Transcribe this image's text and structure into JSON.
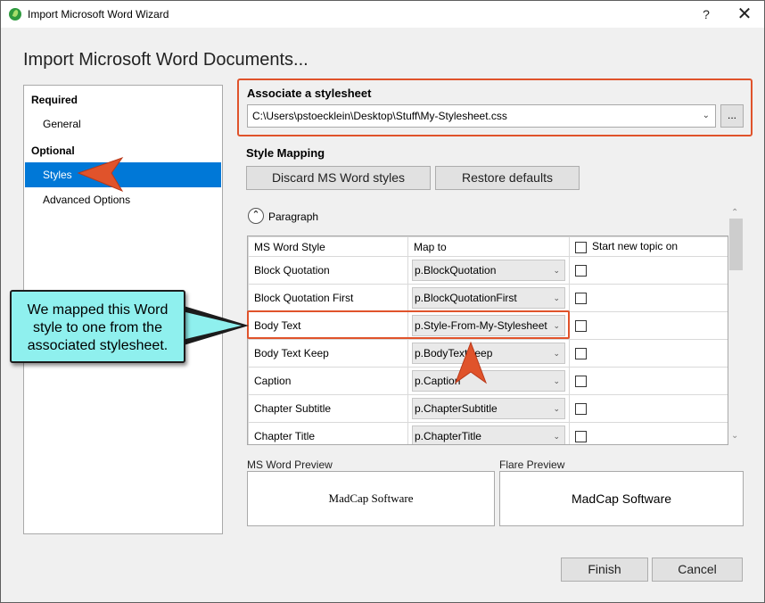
{
  "window": {
    "title": "Import Microsoft Word Wizard",
    "help_label": "?",
    "close_label": "✕",
    "heading": "Import Microsoft Word Documents..."
  },
  "nav": {
    "required_label": "Required",
    "general_label": "General",
    "optional_label": "Optional",
    "styles_label": "Styles",
    "advanced_label": "Advanced Options",
    "selected": "Styles"
  },
  "stylesheet": {
    "title": "Associate a stylesheet",
    "path": "C:\\Users\\pstoecklein\\Desktop\\Stuff\\My-Stylesheet.css",
    "browse_label": "..."
  },
  "style_mapping": {
    "title": "Style Mapping",
    "discard_label": "Discard MS Word styles",
    "restore_label": "Restore defaults",
    "section_label": "Paragraph",
    "columns": [
      "MS Word Style",
      "Map to",
      "Start new topic on"
    ],
    "rows": [
      {
        "style": "Block Quotation",
        "map_to": "p.BlockQuotation"
      },
      {
        "style": "Block Quotation First",
        "map_to": "p.BlockQuotationFirst"
      },
      {
        "style": "Body Text",
        "map_to": "p.Style-From-My-Stylesheet"
      },
      {
        "style": "Body Text Keep",
        "map_to": "p.BodyTextKeep"
      },
      {
        "style": "Caption",
        "map_to": "p.Caption"
      },
      {
        "style": "Chapter Subtitle",
        "map_to": "p.ChapterSubtitle"
      },
      {
        "style": "Chapter Title",
        "map_to": "p.ChapterTitle"
      }
    ]
  },
  "preview": {
    "word_label": "MS Word Preview",
    "word_text": "MadCap Software",
    "flare_label": "Flare Preview",
    "flare_text": "MadCap Software"
  },
  "footer": {
    "finish_label": "Finish",
    "cancel_label": "Cancel"
  },
  "annotation": {
    "callout_text": "We mapped this Word style to one from the associated stylesheet.",
    "accent_color": "#e0532b",
    "callout_color": "#8ff0ee",
    "selection_color": "#0078d7"
  }
}
